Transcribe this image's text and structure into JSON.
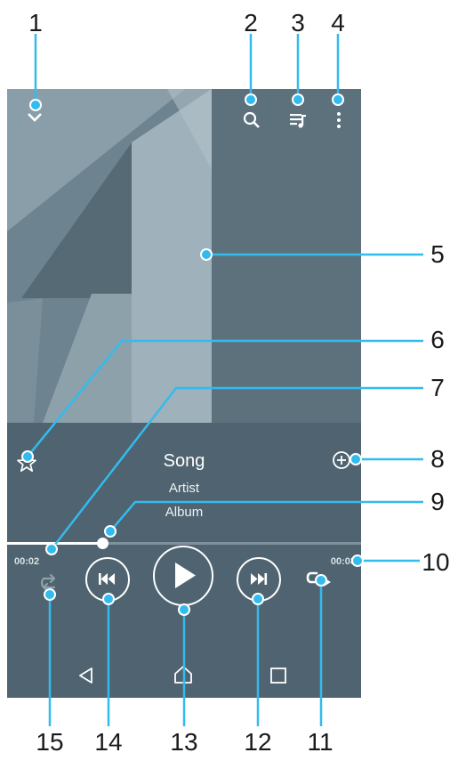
{
  "callouts": [
    "1",
    "2",
    "3",
    "4",
    "5",
    "6",
    "7",
    "8",
    "9",
    "10",
    "11",
    "12",
    "13",
    "14",
    "15"
  ],
  "track": {
    "song": "Song",
    "artist": "Artist",
    "album": "Album",
    "elapsed": "00:02",
    "duration": "00:08",
    "progress": 0.27
  },
  "icons": {
    "collapse": "chevron-down-icon",
    "search": "search-icon",
    "queue": "queue-music-icon",
    "more": "more-vertical-icon",
    "favorite": "star-outline-icon",
    "add": "add-circle-icon",
    "shuffle": "shuffle-icon",
    "previous": "skip-previous-icon",
    "play": "play-icon",
    "next": "skip-next-icon",
    "repeat": "repeat-icon",
    "back": "nav-back-icon",
    "home": "nav-home-icon",
    "recents": "nav-recents-icon"
  },
  "colors": {
    "panel": "#4f6470",
    "accent": "#33bbee"
  }
}
